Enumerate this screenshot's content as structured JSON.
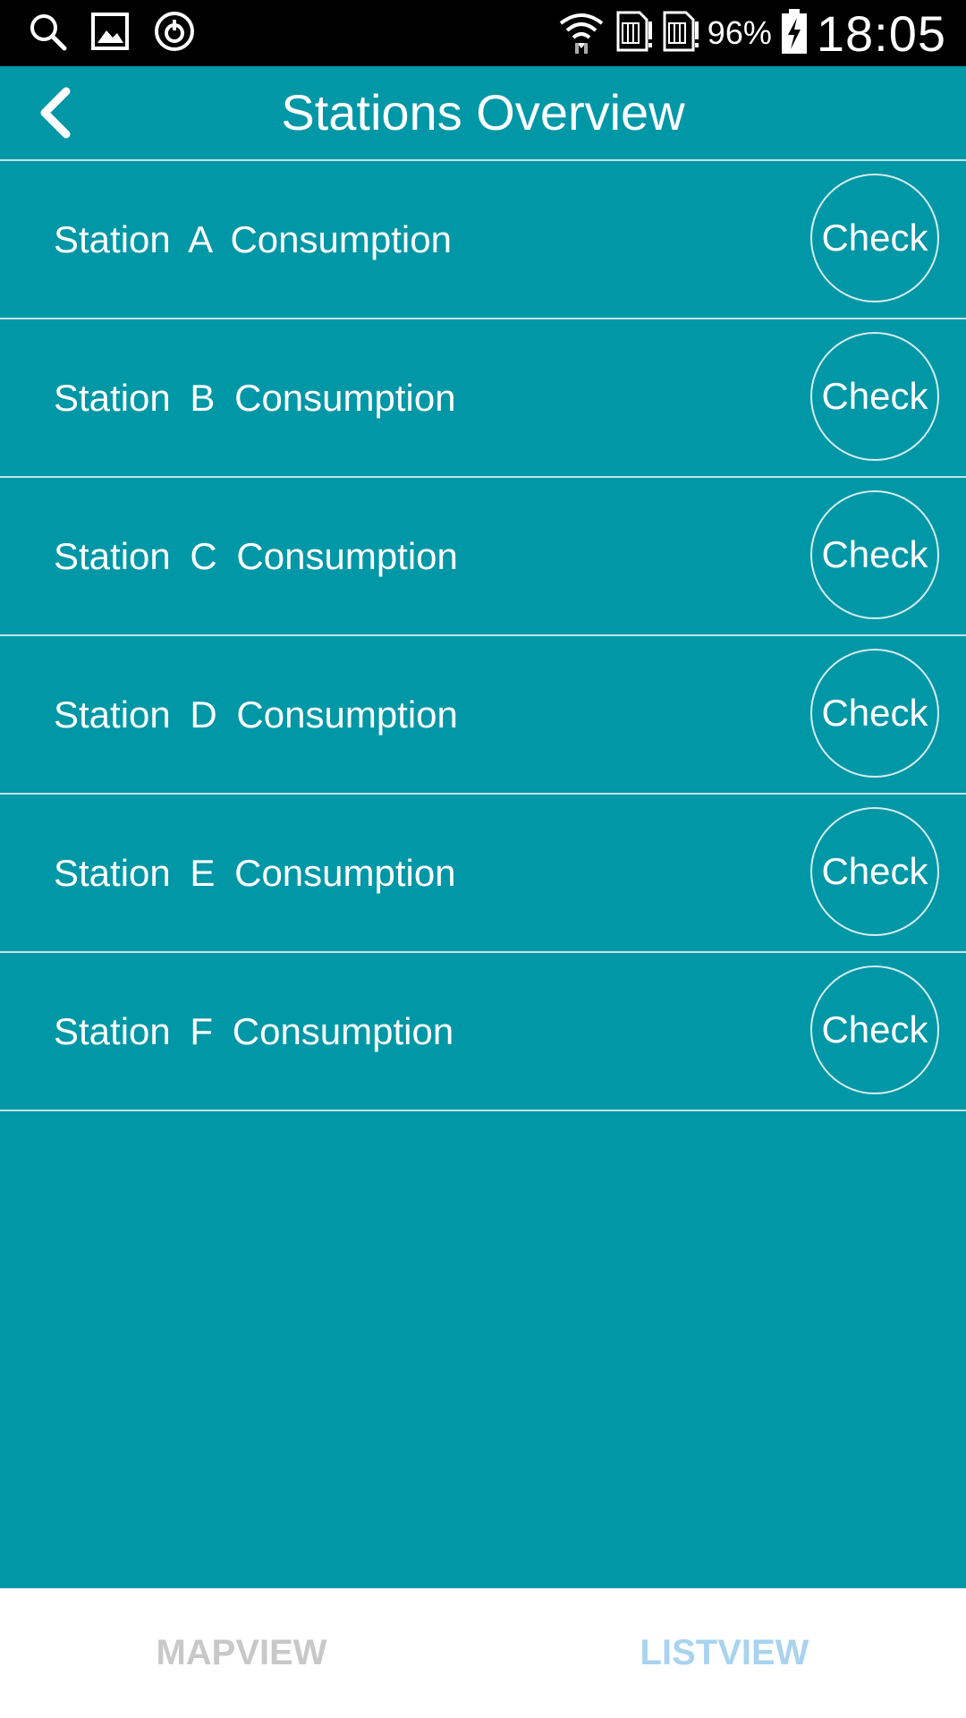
{
  "status_bar": {
    "left_icons": [
      "search-icon",
      "gallery-icon",
      "sync-icon"
    ],
    "right_icons": [
      "wifi-icon",
      "sim1-icon",
      "sim2-icon",
      "battery-charging-icon"
    ],
    "battery": "96%",
    "time": "18:05"
  },
  "header": {
    "title": "Stations Overview",
    "back_icon": "chevron-left-icon"
  },
  "stations": [
    {
      "label": "Station  A  Consumption",
      "button": "Check"
    },
    {
      "label": "Station  B  Consumption",
      "button": "Check"
    },
    {
      "label": "Station  C  Consumption",
      "button": "Check"
    },
    {
      "label": "Station  D  Consumption",
      "button": "Check"
    },
    {
      "label": "Station  E  Consumption",
      "button": "Check"
    },
    {
      "label": "Station  F  Consumption",
      "button": "Check"
    }
  ],
  "tabs": {
    "mapview": "MAPVIEW",
    "listview": "LISTVIEW",
    "active": "listview"
  },
  "colors": {
    "background": "#0097a7",
    "divider": "#bfe6ea",
    "tab_inactive": "#c8c8c8",
    "tab_active": "#a9d3ee"
  }
}
